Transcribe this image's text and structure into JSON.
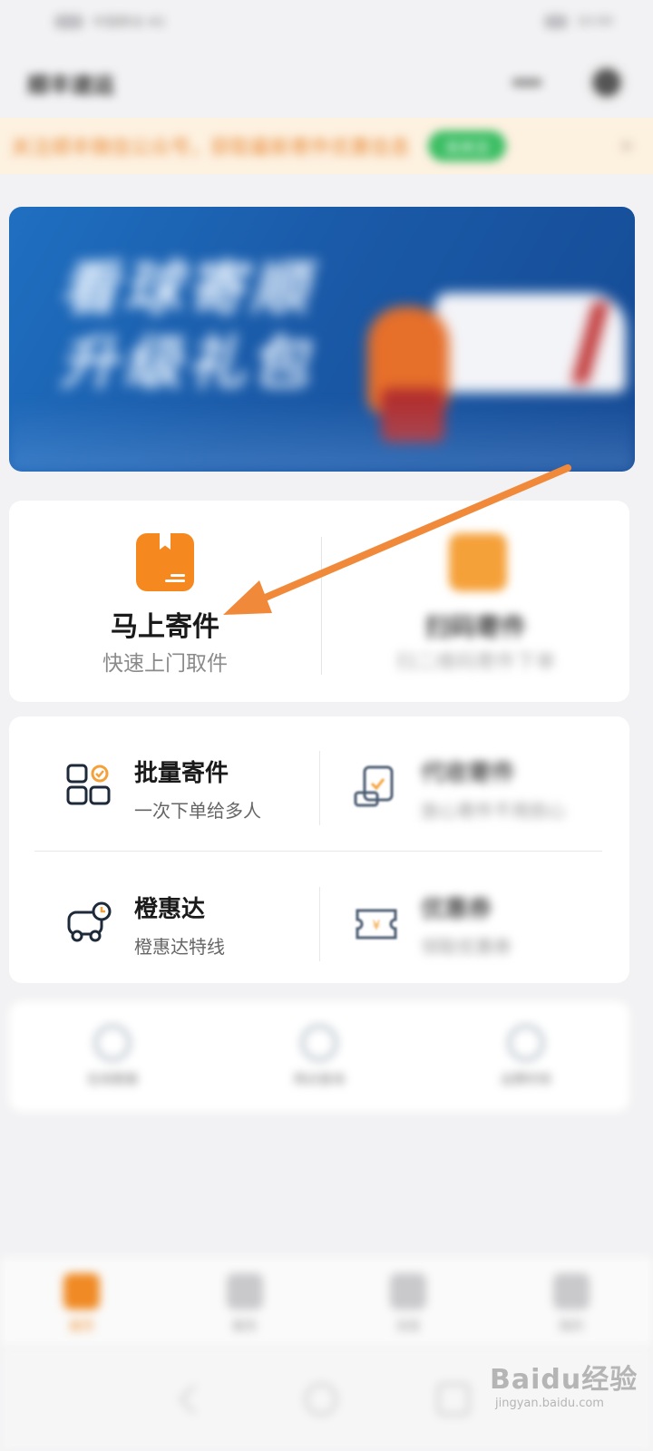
{
  "statusbar": {
    "left": "中国移动 4G",
    "right": "10:00"
  },
  "nav": {
    "title": "顺丰速运"
  },
  "notice": {
    "text": "关注顺丰微信公众号，获取最新寄件优惠信息",
    "button": "去关注"
  },
  "banner": {
    "line1": "看球寄顺",
    "line2": "升级礼包"
  },
  "main_card": {
    "send_now": {
      "title": "马上寄件",
      "subtitle": "快速上门取件"
    },
    "scan_send": {
      "title": "扫码寄件",
      "subtitle": "扫二维码寄件下单"
    }
  },
  "services": [
    {
      "title": "批量寄件",
      "subtitle": "一次下单给多人",
      "icon": "grid-check-icon"
    },
    {
      "title": "代收寄件",
      "subtitle": "放心寄件不用担心",
      "icon": "collect-icon"
    },
    {
      "title": "橙惠达",
      "subtitle": "橙惠达特线",
      "icon": "truck-clock-icon"
    },
    {
      "title": "优惠券",
      "subtitle": "领取优惠券",
      "icon": "coupon-icon"
    }
  ],
  "tools": [
    {
      "label": "在线客服",
      "icon": "chat-icon"
    },
    {
      "label": "网点查询",
      "icon": "location-icon"
    },
    {
      "label": "运费时效",
      "icon": "clock-icon"
    }
  ],
  "tabs": [
    {
      "label": "首页",
      "icon": "home-icon",
      "active": true
    },
    {
      "label": "服务",
      "icon": "service-icon",
      "active": false
    },
    {
      "label": "消息",
      "icon": "message-icon",
      "active": false
    },
    {
      "label": "我的",
      "icon": "profile-icon",
      "active": false
    }
  ],
  "watermark": {
    "brand": "Baidu经验",
    "url": "jingyan.baidu.com"
  },
  "colors": {
    "accent": "#f5891f",
    "banner": "#1a5aa8",
    "notice_bg": "#fdf1e0",
    "notice_btn": "#3cbe64"
  }
}
